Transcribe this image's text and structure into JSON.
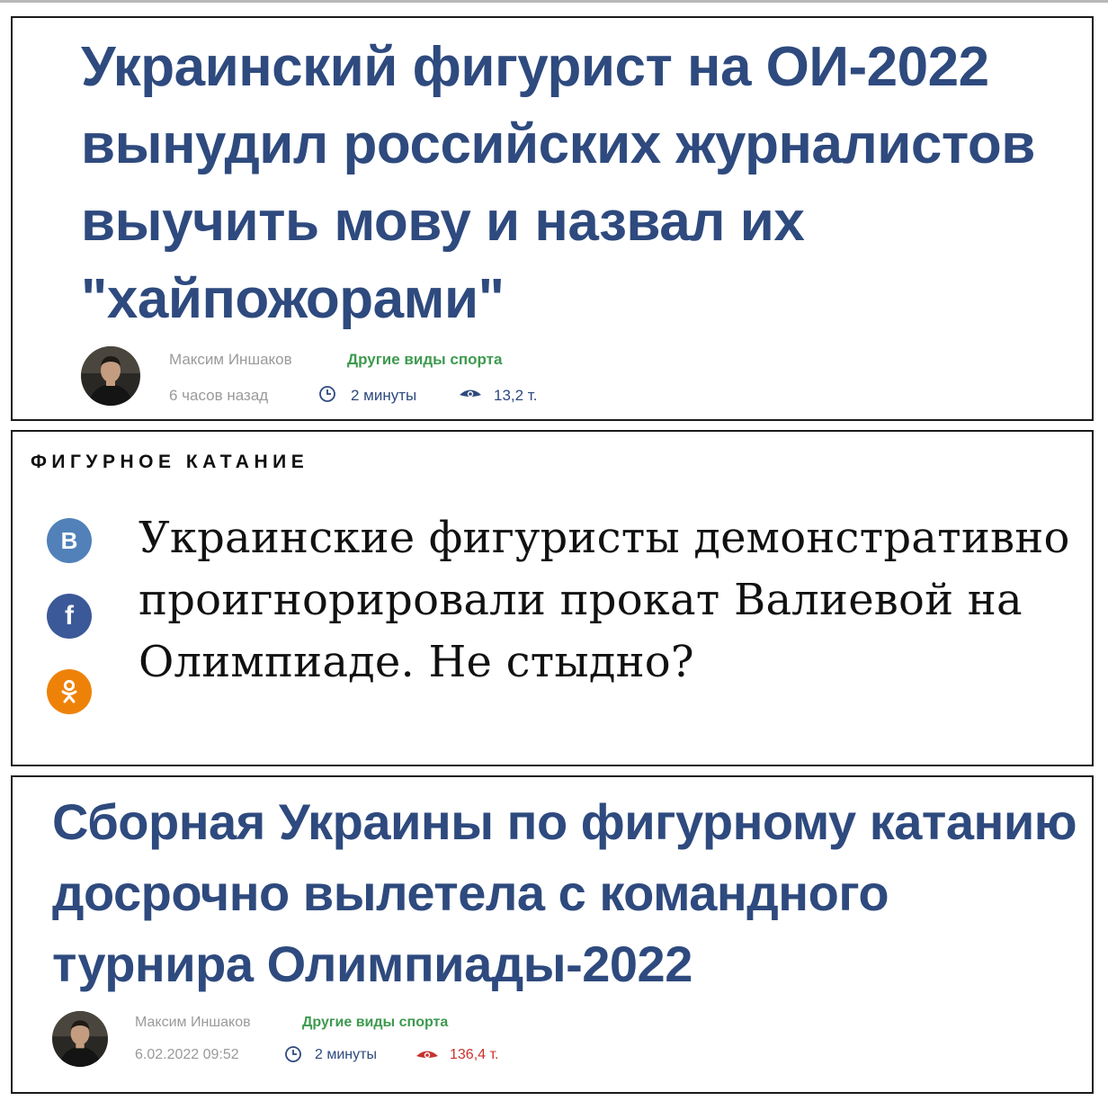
{
  "article1": {
    "headline": "Украинский фигурист на ОИ-2022 вынудил российских журналистов выучить мову и назвал их \"хайпожорами\"",
    "author": "Максим Иншаков",
    "category": "Другие виды спорта",
    "time": "6 часов назад",
    "read_time": "2 минуты",
    "views": "13,2 т."
  },
  "article2": {
    "rubric": "ФИГУРНОЕ КАТАНИЕ",
    "headline": "Украинские фигуристы демонстративно проигнорировали прокат Валиевой на Олимпиаде. Не стыдно?",
    "share": {
      "vk": "В",
      "fb": "f",
      "ok": "ok-icon"
    }
  },
  "article3": {
    "headline": "Сборная Украины по фигурному катанию досрочно вылетела с командного турнира Олимпиады-2022",
    "author": "Максим Иншаков",
    "category": "Другие виды спорта",
    "time": "6.02.2022 09:52",
    "read_time": "2 минуты",
    "views": "136,4 т."
  },
  "colors": {
    "headline": "#2e4a7e",
    "category": "#3e9a4f",
    "views_hot": "#c8322e",
    "vk": "#5181b8",
    "fb": "#3b5998",
    "ok": "#ee8208"
  }
}
